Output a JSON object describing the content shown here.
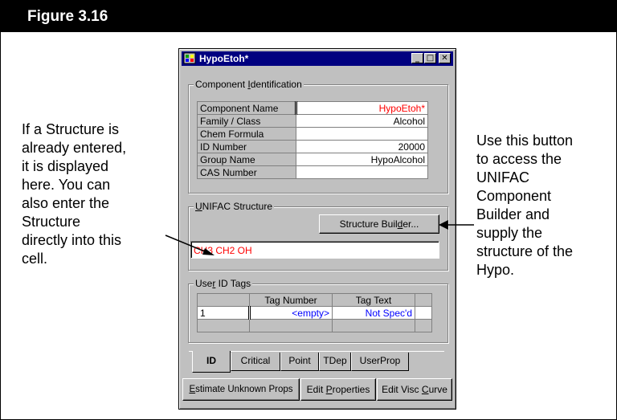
{
  "figure": {
    "title": "Figure 3.16"
  },
  "callouts": {
    "left": "If a Structure is\nalready entered,\nit is displayed\nhere. You can\nalso enter the\nStructure\ndirectly into this\ncell.",
    "right": "Use this button\nto access the\nUNIFAC\nComponent\nBuilder and\nsupply the\nstructure of the\nHypo."
  },
  "window": {
    "title": "HypoEtoh*",
    "controls": {
      "minimize": "_",
      "maximize": "□",
      "close": "✕"
    }
  },
  "component_identification": {
    "label_pre": "Component ",
    "label_key": "I",
    "label_post": "dentification",
    "rows": [
      {
        "name": "Component Name",
        "value": "HypoEtoh*",
        "color": "#ff0000"
      },
      {
        "name": "Family / Class",
        "value": "Alcohol",
        "color": "#000000"
      },
      {
        "name": "Chem Formula",
        "value": "",
        "color": "#000000"
      },
      {
        "name": "ID Number",
        "value": "20000",
        "color": "#000000"
      },
      {
        "name": "Group Name",
        "value": "HypoAlcohol",
        "color": "#000000"
      },
      {
        "name": "CAS Number",
        "value": "",
        "color": "#000000"
      }
    ]
  },
  "unifac": {
    "label_key": "U",
    "label_post": "NIFAC Structure",
    "builder_pre": "Structure Buil",
    "builder_key": "d",
    "builder_post": "er...",
    "structure_value": "CH3 CH2 OH"
  },
  "user_tags": {
    "label_pre": "Use",
    "label_key": "r",
    "label_post": " ID Tags",
    "headers": [
      "Tag Number",
      "Tag Text"
    ],
    "rows": [
      {
        "index": "1",
        "tag_number": "<empty>",
        "tag_text": "Not Spec'd"
      }
    ]
  },
  "tabs": [
    "ID",
    "Critical",
    "Point",
    "TDep",
    "UserProp"
  ],
  "active_tab": "ID",
  "bottom_buttons": [
    {
      "pre": "",
      "key": "E",
      "post": "stimate Unknown Props"
    },
    {
      "pre": "Edit ",
      "key": "P",
      "post": "roperties"
    },
    {
      "pre": "Edit Visc ",
      "key": "C",
      "post": "urve"
    }
  ]
}
